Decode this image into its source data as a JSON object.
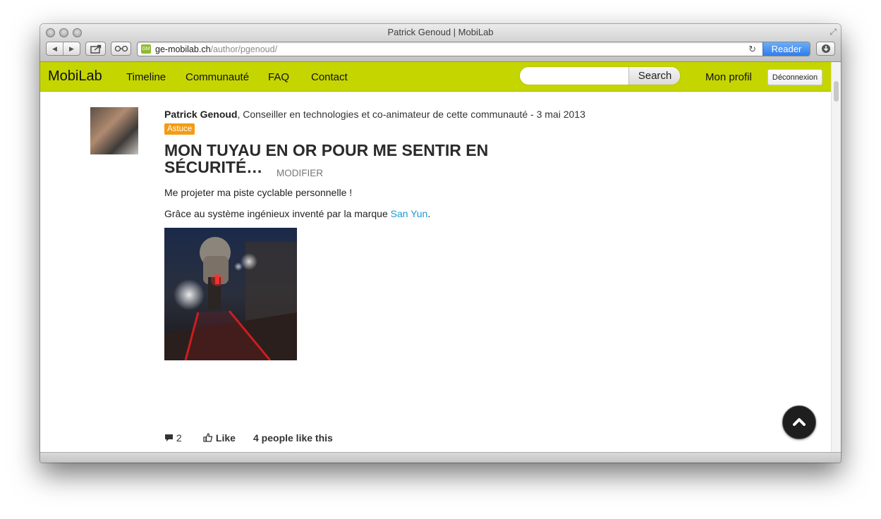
{
  "window": {
    "title": "Patrick Genoud | MobiLab"
  },
  "toolbar": {
    "favicon_text": "GM",
    "url_host": "ge-mobilab.ch",
    "url_path": "/author/pgenoud/",
    "reader_label": "Reader"
  },
  "navbar": {
    "brand": "MobiLab",
    "links": [
      "Timeline",
      "Communauté",
      "FAQ",
      "Contact"
    ],
    "search_value": "",
    "search_button": "Search",
    "profile": "Mon profil",
    "logout": "Déconnexion"
  },
  "post": {
    "author": "Patrick Genoud",
    "author_role": ", Conseiller en technologies et co-animateur de cette communauté - 3 mai 2013",
    "tag": "Astuce",
    "title": "MON TUYAU EN OR POUR ME SENTIR EN SÉCURITÉ…",
    "edit_label": "MODIFIER",
    "paragraph1": "Me projeter ma piste cyclable personnelle !",
    "paragraph2_prefix": "Grâce au système ingénieux inventé par la marque ",
    "paragraph2_link": "San Yun",
    "paragraph2_suffix": ".",
    "comment_count": "2",
    "like_label": "Like",
    "like_summary": "4 people like this"
  },
  "colors": {
    "navbar_bg": "#c5d500",
    "tag_bg": "#f39c12",
    "link": "#1a9bd7",
    "reader_button": "#2d7ae8"
  },
  "icons": {
    "back": "chevron-left-icon",
    "forward": "chevron-right-icon",
    "share": "share-icon",
    "reading_list": "glasses-icon",
    "reload": "reload-icon",
    "download": "download-icon",
    "comment": "comment-icon",
    "like": "thumbs-up-icon",
    "scroll_top": "chevron-up-icon"
  }
}
